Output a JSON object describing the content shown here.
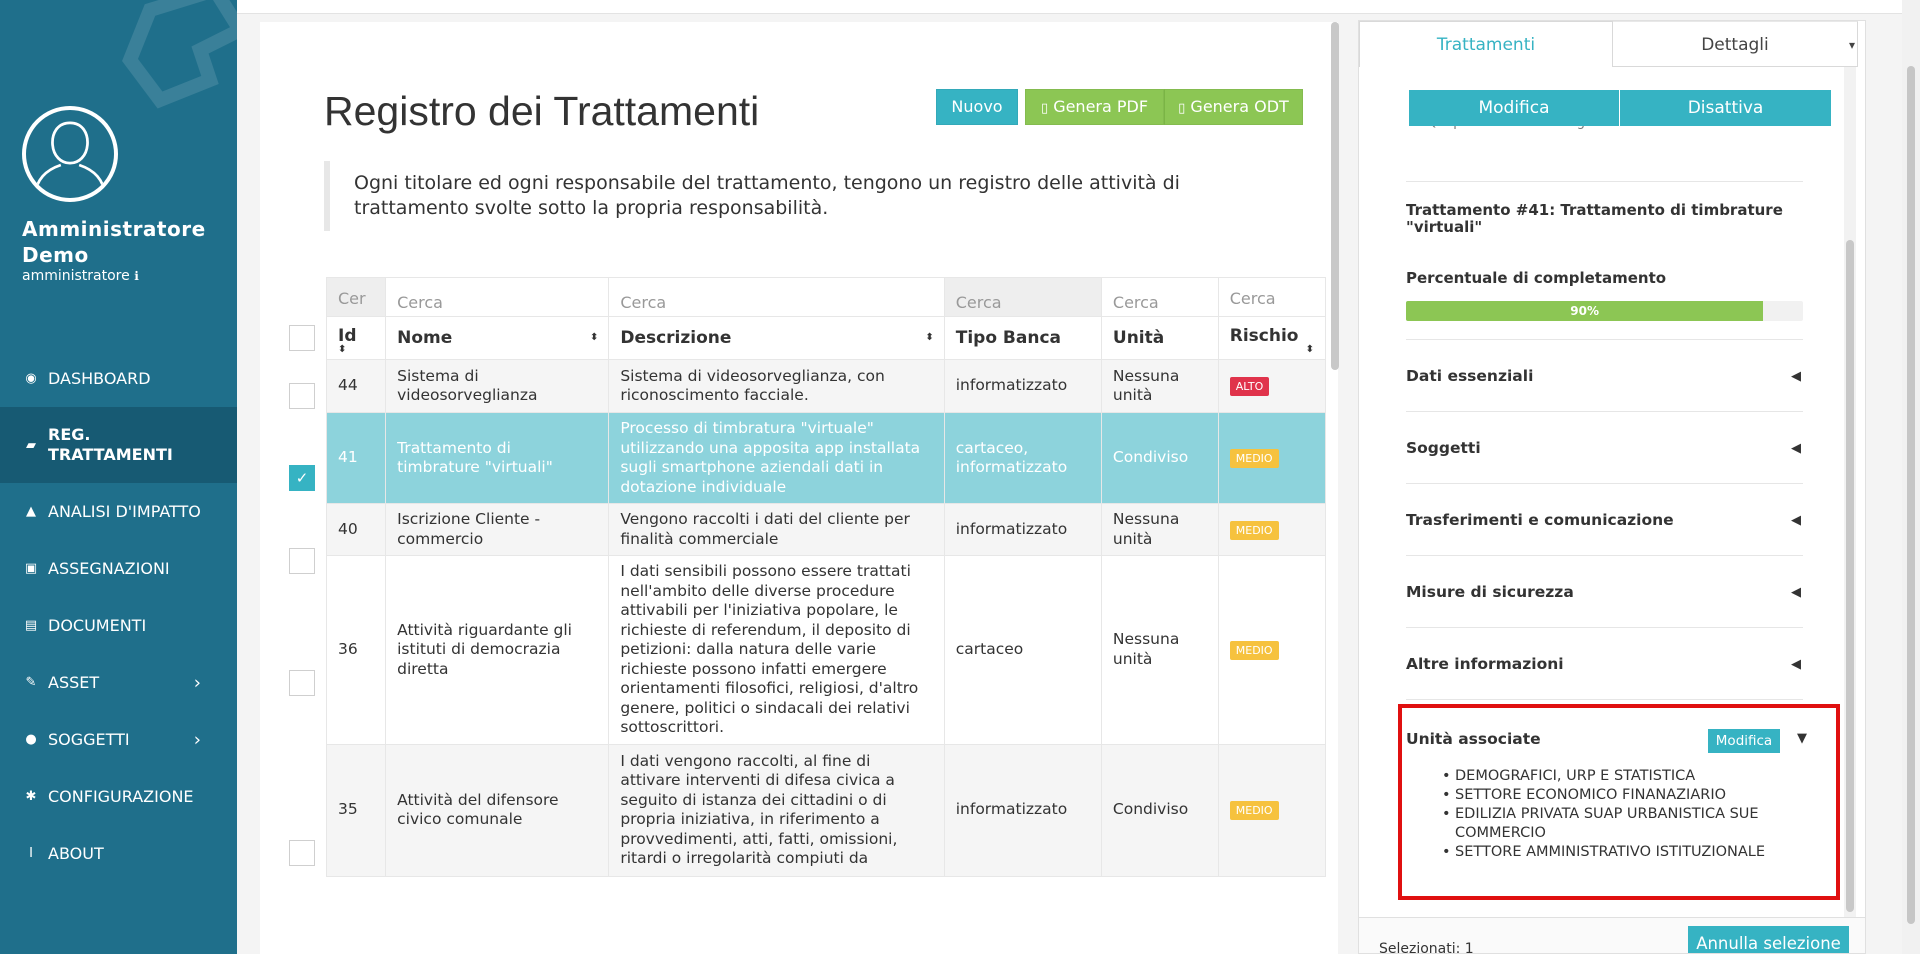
{
  "user": {
    "name": "Amministratore Demo",
    "role": "amministratore",
    "info_glyph": "ℹ"
  },
  "nav": {
    "items": [
      {
        "label": "DASHBOARD",
        "icon": "dashboard-icon",
        "glyph": "◉"
      },
      {
        "label": "REG. TRATTAMENTI",
        "icon": "book-icon",
        "glyph": "▰"
      },
      {
        "label": "ANALISI D'IMPATTO",
        "icon": "warning-icon",
        "glyph": "▲"
      },
      {
        "label": "ASSEGNAZIONI",
        "icon": "clipboard-icon",
        "glyph": "▣"
      },
      {
        "label": "DOCUMENTI",
        "icon": "file-icon",
        "glyph": "▤"
      },
      {
        "label": "ASSET",
        "icon": "edit-icon",
        "glyph": "✎"
      },
      {
        "label": "SOGGETTI",
        "icon": "users-icon",
        "glyph": "●"
      },
      {
        "label": "CONFIGURAZIONE",
        "icon": "gear-icon",
        "glyph": "✱"
      },
      {
        "label": "ABOUT",
        "icon": "info-icon",
        "glyph": "i"
      }
    ],
    "chevron": "›"
  },
  "main": {
    "title": "Registro dei Trattamenti",
    "buttons": {
      "nuovo": "Nuovo",
      "pdf": "Genera PDF",
      "odt": "Genera ODT"
    },
    "quote": "Ogni titolare ed ogni responsabile del trattamento, tengono un registro delle attività di trattamento svolte sotto la propria responsabilità."
  },
  "table": {
    "search": {
      "id": "Cer",
      "nome": "Cerca",
      "descrizione": "Cerca",
      "tipo": "Cerca",
      "unita": "Cerca",
      "rischio": "Cerca"
    },
    "headers": {
      "id": "Id",
      "nome": "Nome",
      "descrizione": "Descrizione",
      "tipo": "Tipo Banca",
      "unita": "Unità",
      "rischio": "Rischio"
    },
    "sort_glyph": "⬍",
    "rows": [
      {
        "id": "44",
        "nome": "Sistema di videosorveglianza",
        "descrizione": "Sistema di videosorveglianza, con riconoscimento facciale.",
        "tipo": "informatizzato",
        "unita": "Nessuna unità",
        "rischio": "ALTO"
      },
      {
        "id": "41",
        "nome": "Trattamento di timbrature \"virtuali\"",
        "descrizione": "Processo di timbratura \"virtuale\" utilizzando una apposita app installata sugli smartphone aziendali dati in dotazione individuale",
        "tipo": "cartaceo, informatizzato",
        "unita": "Condiviso",
        "rischio": "MEDIO"
      },
      {
        "id": "40",
        "nome": "Iscrizione Cliente - commercio",
        "descrizione": "Vengono raccolti i dati del cliente per finalità commerciale",
        "tipo": "informatizzato",
        "unita": "Nessuna unità",
        "rischio": "MEDIO"
      },
      {
        "id": "36",
        "nome": "Attività riguardante gli istituti di democrazia diretta",
        "descrizione": "I dati sensibili possono essere trattati nell'ambito delle diverse procedure attivabili per l'iniziativa popolare, le richieste di referendum, il deposito di petizioni: dalla natura delle varie richieste possono infatti emergere orientamenti filosofici, religiosi, d'altro genere, politici o sindacali dei relativi sottoscrittori.",
        "tipo": "cartaceo",
        "unita": "Nessuna unità",
        "rischio": "MEDIO"
      },
      {
        "id": "35",
        "nome": "Attività del difensore civico comunale",
        "descrizione": "I dati vengono raccolti, al fine di attivare interventi di difesa civica a seguito di istanza dei cittadini o di propria iniziativa, in riferimento a provvedimenti, atti, fatti, omissioni, ritardi o irregolarità compiuti da",
        "tipo": "informatizzato",
        "unita": "Condiviso",
        "rischio": "MEDIO"
      }
    ],
    "check_glyph": "✓"
  },
  "panel": {
    "tabs": [
      "Trattamenti",
      "Dettagli"
    ],
    "caret": "▾",
    "modifica": "Modifica",
    "disattiva": "Disattiva",
    "partial_text": "Qui puoi vedere i dettagli del trattamento selezionato",
    "title": "Trattamento #41: Trattamento di timbrature \"virtuali\"",
    "pct_label": "Percentuale di completamento",
    "pct": 0.9,
    "pct_text": "90%",
    "sections": [
      "Dati essenziali",
      "Soggetti",
      "Trasferimenti e comunicazione",
      "Misure di sicurezza",
      "Altre informazioni"
    ],
    "collapsed_glyph": "◀",
    "expanded_glyph": "▼",
    "units_title": "Unità associate",
    "units_edit": "Modifica",
    "units": [
      "DEMOGRAFICI, URP E STATISTICA",
      "SETTORE ECONOMICO FINANAZIARIO",
      "EDILIZIA PRIVATA SUAP URBANISTICA SUE COMMERCIO",
      "SETTORE AMMINISTRATIVO ISTITUZIONALE"
    ],
    "selected_text": "Selezionati: 1",
    "annulla": "Annulla selezione"
  },
  "colors": {
    "sidebar": "#1f6f8b",
    "accent": "#36b3c3",
    "green": "#8cc654",
    "alto": "#e0334b",
    "medio": "#f6c23e",
    "highlight": "#e01010"
  }
}
